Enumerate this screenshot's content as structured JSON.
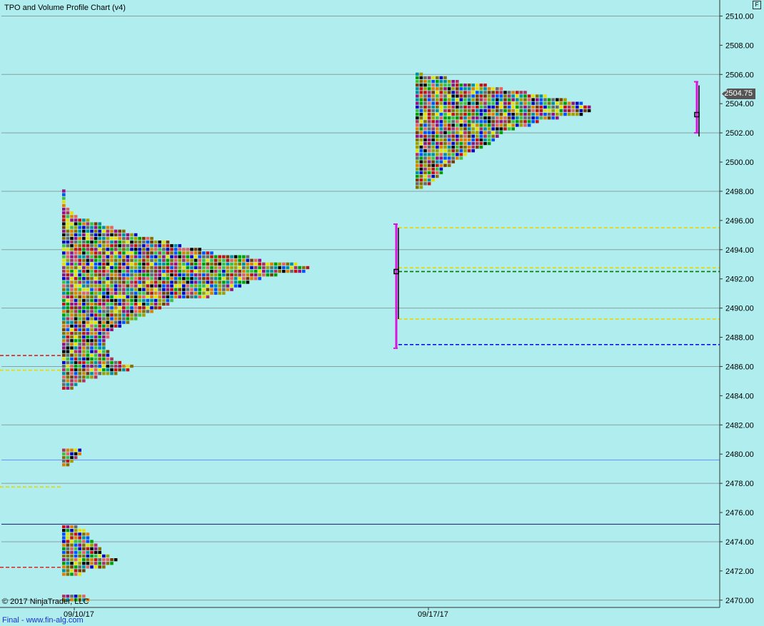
{
  "title": "TPO and Volume Profile Chart (v4)",
  "corner_button": "F",
  "copyright": "© 2017 NinjaTrader, LLC",
  "footer": "Final - www.fin-alg.com",
  "last_price_label": "2504.75",
  "chart_data": {
    "type": "tpo_profile",
    "title": "TPO and Volume Profile Chart (v4)",
    "ylim": [
      2469.5,
      2511.0
    ],
    "y_ticks": [
      "2470.00",
      "2472.00",
      "2474.00",
      "2476.00",
      "2478.00",
      "2480.00",
      "2482.00",
      "2484.00",
      "2486.00",
      "2488.00",
      "2490.00",
      "2492.00",
      "2494.00",
      "2496.00",
      "2498.00",
      "2500.00",
      "2502.00",
      "2504.00",
      "2506.00",
      "2508.00",
      "2510.00"
    ],
    "x_ticks": [
      "09/10/17",
      "09/17/17"
    ],
    "grid": true,
    "last_price": 2504.75,
    "profiles": [
      {
        "session": "09/10/17",
        "tpo_counts": [
          [
            2470.0,
            7
          ],
          [
            2470.25,
            6
          ],
          [
            2471.75,
            5
          ],
          [
            2472.0,
            6
          ],
          [
            2472.25,
            11
          ],
          [
            2472.5,
            13
          ],
          [
            2472.75,
            14
          ],
          [
            2473.0,
            12
          ],
          [
            2473.25,
            10
          ],
          [
            2473.5,
            10
          ],
          [
            2473.75,
            9
          ],
          [
            2474.0,
            8
          ],
          [
            2474.25,
            7
          ],
          [
            2474.5,
            7
          ],
          [
            2474.75,
            6
          ],
          [
            2475.0,
            4
          ],
          [
            2479.25,
            2
          ],
          [
            2479.5,
            3
          ],
          [
            2479.75,
            4
          ],
          [
            2480.0,
            5
          ],
          [
            2480.25,
            5
          ],
          [
            2484.5,
            3
          ],
          [
            2484.75,
            4
          ],
          [
            2485.0,
            6
          ],
          [
            2485.25,
            9
          ],
          [
            2485.5,
            14
          ],
          [
            2485.75,
            17
          ],
          [
            2486.0,
            18
          ],
          [
            2486.25,
            15
          ],
          [
            2486.5,
            13
          ],
          [
            2486.75,
            12
          ],
          [
            2487.0,
            12
          ],
          [
            2487.25,
            11
          ],
          [
            2487.5,
            11
          ],
          [
            2487.75,
            11
          ],
          [
            2488.0,
            12
          ],
          [
            2488.25,
            12
          ],
          [
            2488.5,
            13
          ],
          [
            2488.75,
            15
          ],
          [
            2489.0,
            17
          ],
          [
            2489.25,
            19
          ],
          [
            2489.5,
            21
          ],
          [
            2489.75,
            23
          ],
          [
            2490.0,
            25
          ],
          [
            2490.25,
            27
          ],
          [
            2490.5,
            28
          ],
          [
            2490.75,
            37
          ],
          [
            2491.0,
            41
          ],
          [
            2491.25,
            43
          ],
          [
            2491.5,
            45
          ],
          [
            2491.75,
            47
          ],
          [
            2492.0,
            50
          ],
          [
            2492.25,
            54
          ],
          [
            2492.5,
            61
          ],
          [
            2492.75,
            62
          ],
          [
            2493.0,
            59
          ],
          [
            2493.25,
            50
          ],
          [
            2493.5,
            47
          ],
          [
            2493.75,
            38
          ],
          [
            2494.0,
            35
          ],
          [
            2494.25,
            30
          ],
          [
            2494.5,
            27
          ],
          [
            2494.75,
            23
          ],
          [
            2495.0,
            19
          ],
          [
            2495.25,
            16
          ],
          [
            2495.5,
            13
          ],
          [
            2495.75,
            10
          ],
          [
            2496.0,
            7
          ],
          [
            2496.25,
            4
          ],
          [
            2496.5,
            3
          ],
          [
            2496.75,
            2
          ],
          [
            2497.0,
            1
          ],
          [
            2497.25,
            1
          ],
          [
            2497.5,
            1
          ],
          [
            2497.75,
            1
          ],
          [
            2498.0,
            1
          ]
        ],
        "poc": 2492.5,
        "value_area_high": 2495.5,
        "value_area_low": 2489.25,
        "range_high": 2495.75,
        "range_low": 2487.25,
        "extension_lines": [
          {
            "price": 2487.5,
            "color": "#0000ff"
          },
          {
            "price": 2492.5,
            "color": "#007a00"
          },
          {
            "price": 2495.5,
            "color": "#e8d800"
          },
          {
            "price": 2492.75,
            "color": "#e8d800"
          },
          {
            "price": 2489.25,
            "color": "#e8d800"
          }
        ]
      },
      {
        "session": "09/17/17",
        "tpo_counts": [
          [
            2498.25,
            2
          ],
          [
            2498.5,
            4
          ],
          [
            2498.75,
            5
          ],
          [
            2499.0,
            6
          ],
          [
            2499.25,
            7
          ],
          [
            2499.5,
            7
          ],
          [
            2499.75,
            9
          ],
          [
            2500.0,
            10
          ],
          [
            2500.25,
            12
          ],
          [
            2500.5,
            13
          ],
          [
            2500.75,
            15
          ],
          [
            2501.0,
            17
          ],
          [
            2501.25,
            19
          ],
          [
            2501.5,
            20
          ],
          [
            2501.75,
            21
          ],
          [
            2502.0,
            22
          ],
          [
            2502.25,
            25
          ],
          [
            2502.5,
            29
          ],
          [
            2502.75,
            31
          ],
          [
            2503.0,
            36
          ],
          [
            2503.25,
            42
          ],
          [
            2503.5,
            44
          ],
          [
            2503.75,
            44
          ],
          [
            2504.0,
            42
          ],
          [
            2504.25,
            38
          ],
          [
            2504.5,
            33
          ],
          [
            2504.75,
            28
          ],
          [
            2505.0,
            22
          ],
          [
            2505.25,
            18
          ],
          [
            2505.5,
            11
          ],
          [
            2505.75,
            8
          ],
          [
            2506.0,
            2
          ]
        ],
        "poc": 2503.25,
        "value_area_high": 2505.25,
        "value_area_low": 2501.75,
        "range_high": 2505.5,
        "range_low": 2502.0
      }
    ],
    "prior_levels": [
      {
        "price": 2486.75,
        "color": "#e02020"
      },
      {
        "price": 2485.75,
        "color": "#e8d800"
      },
      {
        "price": 2477.75,
        "color": "#e8d800"
      },
      {
        "price": 2472.25,
        "color": "#e02020"
      }
    ],
    "reference_lines": [
      {
        "price": 2479.6,
        "color": "#6a8cff"
      },
      {
        "price": 2475.2,
        "color": "#1a1a6a"
      }
    ],
    "palette": [
      "#c81010",
      "#e08000",
      "#e8e000",
      "#00a000",
      "#0000c8",
      "#000000",
      "#6a6a6a",
      "#8a7000",
      "#0090a0",
      "#9a1080",
      "#e86060",
      "#40c040",
      "#a0a000",
      "#0050ff",
      "#b03060",
      "#7a3a00"
    ]
  }
}
